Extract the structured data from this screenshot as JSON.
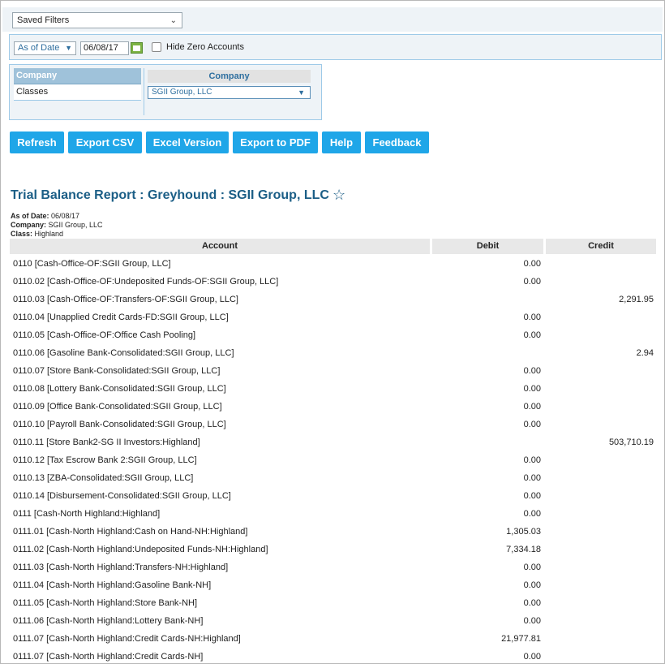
{
  "filters": {
    "saved_filters_label": "Saved Filters",
    "date_type": "As of Date",
    "date_value": "06/08/17",
    "hide_zero_label": "Hide Zero Accounts"
  },
  "dimensions": {
    "items": [
      "Company",
      "Classes"
    ],
    "header": "Company",
    "selected_value": "SGII Group, LLC"
  },
  "toolbar": {
    "refresh": "Refresh",
    "export_csv": "Export CSV",
    "excel_version": "Excel Version",
    "export_pdf": "Export to PDF",
    "help": "Help",
    "feedback": "Feedback"
  },
  "report": {
    "title": "Trial Balance Report : Greyhound : SGII Group, LLC",
    "as_of_label": "As of Date:",
    "as_of_value": "06/08/17",
    "company_label": "Company:",
    "company_value": "SGII Group, LLC",
    "class_label": "Class:",
    "class_value": "Highland",
    "columns": [
      "Account",
      "Debit",
      "Credit"
    ],
    "rows": [
      {
        "account": "0110 [Cash-Office-OF:SGII Group, LLC]",
        "debit": "0.00",
        "credit": ""
      },
      {
        "account": "0110.02 [Cash-Office-OF:Undeposited Funds-OF:SGII Group, LLC]",
        "debit": "0.00",
        "credit": ""
      },
      {
        "account": "0110.03 [Cash-Office-OF:Transfers-OF:SGII Group, LLC]",
        "debit": "",
        "credit": "2,291.95"
      },
      {
        "account": "0110.04 [Unapplied Credit Cards-FD:SGII Group, LLC]",
        "debit": "0.00",
        "credit": ""
      },
      {
        "account": "0110.05 [Cash-Office-OF:Office Cash Pooling]",
        "debit": "0.00",
        "credit": ""
      },
      {
        "account": "0110.06 [Gasoline Bank-Consolidated:SGII Group, LLC]",
        "debit": "",
        "credit": "2.94"
      },
      {
        "account": "0110.07 [Store Bank-Consolidated:SGII Group, LLC]",
        "debit": "0.00",
        "credit": ""
      },
      {
        "account": "0110.08 [Lottery Bank-Consolidated:SGII Group, LLC]",
        "debit": "0.00",
        "credit": ""
      },
      {
        "account": "0110.09 [Office Bank-Consolidated:SGII Group, LLC]",
        "debit": "0.00",
        "credit": ""
      },
      {
        "account": "0110.10 [Payroll Bank-Consolidated:SGII Group, LLC]",
        "debit": "0.00",
        "credit": ""
      },
      {
        "account": "0110.11 [Store Bank2-SG II Investors:Highland]",
        "debit": "",
        "credit": "503,710.19"
      },
      {
        "account": "0110.12 [Tax Escrow Bank 2:SGII Group, LLC]",
        "debit": "0.00",
        "credit": ""
      },
      {
        "account": "0110.13 [ZBA-Consolidated:SGII Group, LLC]",
        "debit": "0.00",
        "credit": ""
      },
      {
        "account": "0110.14 [Disbursement-Consolidated:SGII Group, LLC]",
        "debit": "0.00",
        "credit": ""
      },
      {
        "account": "0111 [Cash-North Highland:Highland]",
        "debit": "0.00",
        "credit": ""
      },
      {
        "account": "0111.01 [Cash-North Highland:Cash on Hand-NH:Highland]",
        "debit": "1,305.03",
        "credit": ""
      },
      {
        "account": "0111.02 [Cash-North Highland:Undeposited Funds-NH:Highland]",
        "debit": "7,334.18",
        "credit": ""
      },
      {
        "account": "0111.03 [Cash-North Highland:Transfers-NH:Highland]",
        "debit": "0.00",
        "credit": ""
      },
      {
        "account": "0111.04 [Cash-North Highland:Gasoline Bank-NH]",
        "debit": "0.00",
        "credit": ""
      },
      {
        "account": "0111.05 [Cash-North Highland:Store Bank-NH]",
        "debit": "0.00",
        "credit": ""
      },
      {
        "account": "0111.06 [Cash-North Highland:Lottery Bank-NH]",
        "debit": "0.00",
        "credit": ""
      },
      {
        "account": "0111.07 [Cash-North Highland:Credit Cards-NH:Highland]",
        "debit": "21,977.81",
        "credit": ""
      },
      {
        "account": "0111.07 [Cash-North Highland:Credit Cards-NH]",
        "debit": "0.00",
        "credit": ""
      }
    ]
  },
  "icons": {
    "dropdown": "chevron-down-icon",
    "calendar": "calendar-icon",
    "favorite": "star-icon"
  },
  "colors": {
    "button_bg": "#1fa6e8",
    "title": "#1b5e86",
    "panel_bg": "#eef3f7",
    "panel_border": "#9ecae8"
  }
}
